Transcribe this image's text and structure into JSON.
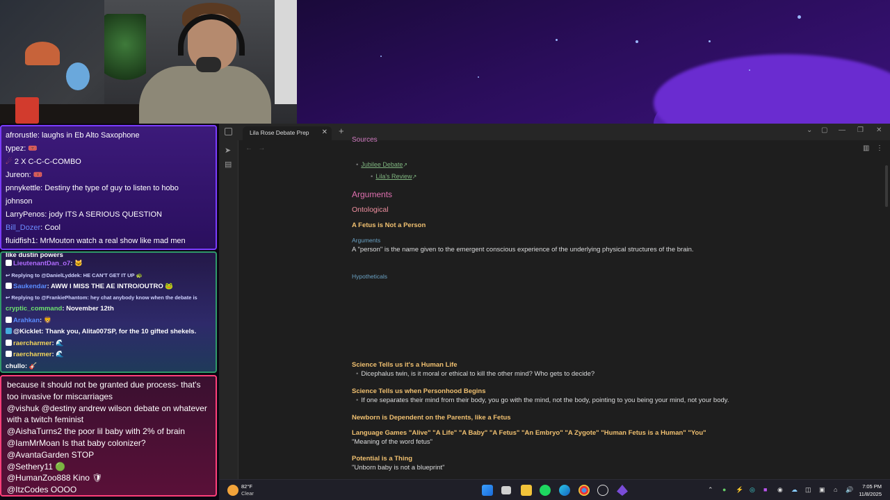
{
  "chat_top": [
    {
      "user": "afrorustle",
      "text": "laughs in Eb Alto Saxophone"
    },
    {
      "user": "typez",
      "text": "🎟️"
    },
    {
      "user": "",
      "text": "2 X C-C-C-COMBO"
    },
    {
      "user": "Jureon",
      "text": "🎟️"
    },
    {
      "user": "pnnykettle",
      "text": "Destiny the type of guy to listen to hobo"
    },
    {
      "user": "",
      "text": "johnson"
    },
    {
      "user": "LarryPenos",
      "text": "jody ITS A SERIOUS QUESTION"
    },
    {
      "user": "Bill_Dozer",
      "text": "Cool"
    },
    {
      "user": "fluidfish1",
      "text": "MrMouton watch a real show like mad men"
    }
  ],
  "chat_mid": [
    {
      "type": "msg",
      "user": "",
      "text": "like dustin powers"
    },
    {
      "type": "msg",
      "user": "LieutenantDan_o7",
      "text": "🐱"
    },
    {
      "type": "reply",
      "text": "Replying to @DanielLyddek: HE CAN'T GET IT UP 🐢"
    },
    {
      "type": "msg",
      "user": "Saukendar",
      "text": "AWW I MISS THE AE INTRO/OUTRO 🐸"
    },
    {
      "type": "reply",
      "text": "Replying to @FrankiePhantom: hey chat anybody know when the debate is"
    },
    {
      "type": "msg",
      "user": "cryptic_command",
      "text": "November 12th"
    },
    {
      "type": "msg",
      "user": "Arahkan",
      "text": "🦁"
    },
    {
      "type": "msg",
      "user": "@Kicklet",
      "text": "Thank you, Alita007SP, for the 10 gifted shekels."
    },
    {
      "type": "msg",
      "user": "raercharmer",
      "text": "🌊"
    },
    {
      "type": "msg",
      "user": "raercharmer",
      "text": "🌊"
    },
    {
      "type": "msg",
      "user": "chullo",
      "text": "🎸"
    }
  ],
  "chat_bot": [
    {
      "text": "because it should not be granted due process- that's too invasive for miscarriages"
    },
    {
      "text": "@vishuk @destiny andrew wilson debate on whatever with a twitch feminist"
    },
    {
      "text": "@AishaTurns2 the poor lil baby with 2% of brain"
    },
    {
      "text": "@IamMrMoan Is that baby colonizer?"
    },
    {
      "text": "@AvantaGarden STOP"
    },
    {
      "text": "@Sethery11 🟢"
    },
    {
      "text": "@HumanZoo888 Kino 🛡"
    },
    {
      "text": "@ItzCodes OOOO"
    }
  ],
  "obsidian": {
    "tab_title": "Lila Rose Debate Prep",
    "sources_heading": "Sources",
    "link_jubilee": "Jubilee Debate",
    "link_lila": "Lila's Review",
    "h_arguments": "Arguments",
    "h_ontological": "Ontological",
    "h_fetus_not_person": "A Fetus is Not a Person",
    "h_arguments_sub": "Arguments",
    "p_person": "A \"person\" is the name given to the emergent conscious experience of the underlying physical structures of the brain.",
    "h_hypotheticals": "Hypotheticals",
    "h_science_human": "Science Tells us it's a Human Life",
    "b_dicephalus": "Dicephalus twin, is it moral or ethical to kill the other mind? Who gets to decide?",
    "h_science_personhood": "Science Tells us when Personhood Begins",
    "b_separates": "If one separates their mind from their body, you go with the mind, not the body, pointing to you being your mind, not your body.",
    "h_newborn": "Newborn is Dependent on the Parents, like a Fetus",
    "h_language": "Language Games \"Alive\" \"A Life\" \"A Baby\" \"A Fetus\" \"An Embryo\" \"A Zygote\" \"Human Fetus is a Human\" \"You\"",
    "p_meaning": "\"Meaning of the word fetus\"",
    "h_potential": "Potential is a Thing",
    "p_unborn": "\"Unborn baby is not a blueprint\""
  },
  "taskbar": {
    "temp": "82°F",
    "condition": "Clear",
    "time": "7:05 PM",
    "date": "11/8/2025"
  }
}
